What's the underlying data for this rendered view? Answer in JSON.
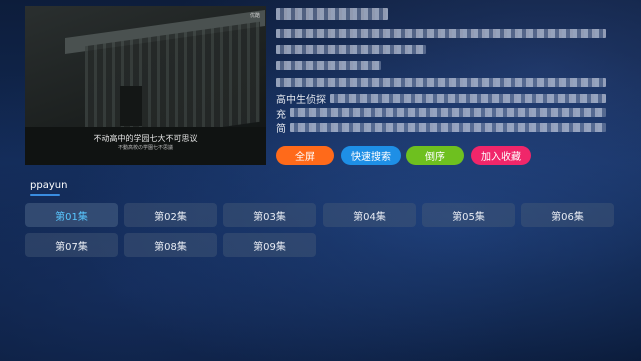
{
  "player": {
    "subtitle_main": "不动高中的学园七大不可思议",
    "subtitle_small": "不動高校の学園七不思議",
    "corner_tag": "优酷"
  },
  "info": {
    "fields": [
      {
        "label": "高中生侦探"
      },
      {
        "label": "充"
      },
      {
        "label": "简"
      }
    ]
  },
  "actions": [
    {
      "label": "全屏",
      "color": "#ff6a1a"
    },
    {
      "label": "快速搜索",
      "color": "#1e8fe6"
    },
    {
      "label": "倒序",
      "color": "#6ec01f"
    },
    {
      "label": "加入收藏",
      "color": "#f0266a"
    }
  ],
  "source": {
    "label": "ppayun"
  },
  "episodes": [
    "第01集",
    "第02集",
    "第03集",
    "第04集",
    "第05集",
    "第06集",
    "第07集",
    "第08集",
    "第09集"
  ],
  "active_episode": "第01集"
}
